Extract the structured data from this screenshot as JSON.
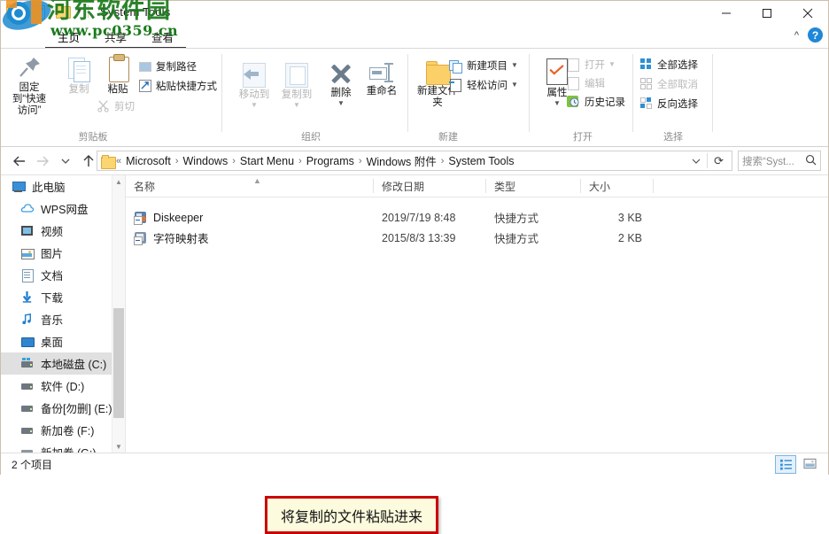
{
  "window": {
    "title": "System Tools",
    "minimize_label": "minimize",
    "maximize_label": "maximize",
    "close_label": "close"
  },
  "quick_access": {
    "items": [
      "new-folder-icon",
      "properties-icon",
      "customize-chevron-icon"
    ]
  },
  "ribbon": {
    "tabs": [
      {
        "label": "主页",
        "active": true
      },
      {
        "label": "共享",
        "active": false
      },
      {
        "label": "查看",
        "active": false
      }
    ],
    "help_label": "?",
    "groups": [
      {
        "name": "clipboard",
        "label": "剪贴板",
        "buttons": [
          {
            "label": "固定到“快速访问”",
            "enabled": true
          },
          {
            "label": "复制",
            "enabled": false
          },
          {
            "label": "粘贴",
            "enabled": true
          }
        ],
        "small_items": [
          {
            "label": "复制路径",
            "enabled": true
          },
          {
            "label": "粘贴快捷方式",
            "enabled": true
          },
          {
            "label": "剪切",
            "enabled": false
          }
        ]
      },
      {
        "name": "organize",
        "label": "组织",
        "buttons": [
          {
            "label": "移动到",
            "enabled": false
          },
          {
            "label": "复制到",
            "enabled": false
          },
          {
            "label": "删除",
            "enabled": true
          },
          {
            "label": "重命名",
            "enabled": true
          }
        ]
      },
      {
        "name": "new",
        "label": "新建",
        "buttons": [
          {
            "label": "新建文件夹",
            "enabled": true
          }
        ],
        "small_items": [
          {
            "label": "新建项目",
            "enabled": true
          },
          {
            "label": "轻松访问",
            "enabled": true
          }
        ]
      },
      {
        "name": "open",
        "label": "打开",
        "buttons": [
          {
            "label": "属性",
            "enabled": true
          }
        ],
        "small_items": [
          {
            "label": "打开",
            "enabled": false
          },
          {
            "label": "编辑",
            "enabled": false
          },
          {
            "label": "历史记录",
            "enabled": true
          }
        ]
      },
      {
        "name": "select",
        "label": "选择",
        "small_items": [
          {
            "label": "全部选择",
            "enabled": true
          },
          {
            "label": "全部取消",
            "enabled": false
          },
          {
            "label": "反向选择",
            "enabled": true
          }
        ]
      }
    ]
  },
  "address_bar": {
    "back_label": "←",
    "forward_label": "→",
    "recent_label": "∨",
    "up_label": "↑",
    "overflow": "«",
    "breadcrumbs": [
      "Microsoft",
      "Windows",
      "Start Menu",
      "Programs",
      "Windows 附件",
      "System Tools"
    ],
    "dropdown_label": "∨",
    "refresh_label": "⟳"
  },
  "search": {
    "placeholder": "搜索“Syst...",
    "icon": "search-icon"
  },
  "sidebar": {
    "items": [
      {
        "label": "此电脑",
        "icon": "computer-icon",
        "level": 0,
        "selected": false
      },
      {
        "label": "WPS网盘",
        "icon": "cloud-icon",
        "level": 1,
        "selected": false
      },
      {
        "label": "视频",
        "icon": "video-icon",
        "level": 1,
        "selected": false
      },
      {
        "label": "图片",
        "icon": "pictures-icon",
        "level": 1,
        "selected": false
      },
      {
        "label": "文档",
        "icon": "documents-icon",
        "level": 1,
        "selected": false
      },
      {
        "label": "下载",
        "icon": "downloads-icon",
        "level": 1,
        "selected": false
      },
      {
        "label": "音乐",
        "icon": "music-icon",
        "level": 1,
        "selected": false
      },
      {
        "label": "桌面",
        "icon": "desktop-icon",
        "level": 1,
        "selected": false
      },
      {
        "label": "本地磁盘 (C:)",
        "icon": "drive-icon",
        "level": 1,
        "selected": true
      },
      {
        "label": "软件 (D:)",
        "icon": "drive-icon",
        "level": 1,
        "selected": false
      },
      {
        "label": "备份[勿删] (E:)",
        "icon": "drive-icon",
        "level": 1,
        "selected": false
      },
      {
        "label": "新加卷 (F:)",
        "icon": "drive-icon",
        "level": 1,
        "selected": false
      },
      {
        "label": "新加卷 (G:)",
        "icon": "drive-icon",
        "level": 1,
        "selected": false
      }
    ]
  },
  "file_list": {
    "columns": [
      {
        "label": "名称",
        "sorted": true
      },
      {
        "label": "修改日期",
        "sorted": false
      },
      {
        "label": "类型",
        "sorted": false
      },
      {
        "label": "大小",
        "sorted": false
      }
    ],
    "rows": [
      {
        "name": "Diskeeper",
        "modified": "2019/7/19 8:48",
        "type": "快捷方式",
        "size": "3 KB",
        "icon": "shortcut-icon"
      },
      {
        "name": "字符映射表",
        "modified": "2015/8/3 13:39",
        "type": "快捷方式",
        "size": "2 KB",
        "icon": "shortcut-icon"
      }
    ]
  },
  "annotation": {
    "text": "将复制的文件粘贴进来",
    "border_color": "#cc0000",
    "background_color": "#fdfbdd"
  },
  "status_bar": {
    "item_count": "2 个项目",
    "view_buttons": [
      {
        "name": "details-view-button",
        "active": true
      },
      {
        "name": "large-icons-view-button",
        "active": false
      }
    ]
  },
  "watermark": {
    "text": "河东软件园",
    "url": "www.pc0359.cn",
    "color": "#1a7a1a"
  }
}
